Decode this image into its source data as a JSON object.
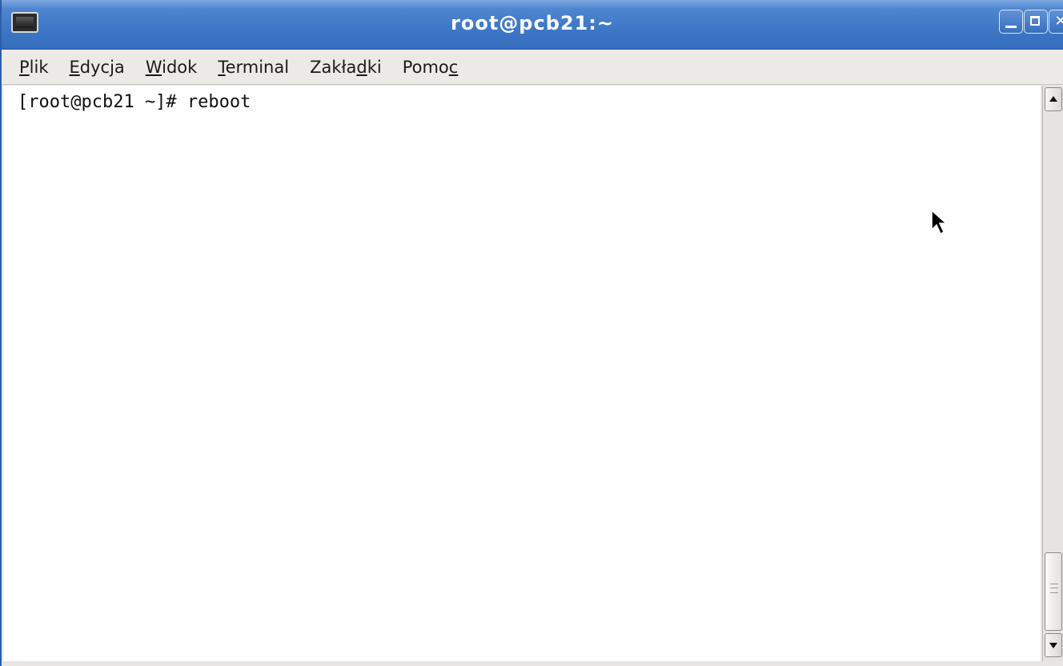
{
  "window": {
    "title": "root@pcb21:~",
    "icon": "terminal-icon",
    "controls": {
      "minimize_icon": "minimize-icon",
      "maximize_icon": "maximize-icon",
      "close_icon": "close-icon",
      "close_glyph": "✕"
    },
    "colors": {
      "titlebar": "#3f78c7",
      "menubar": "#eceae7",
      "terminal_bg": "#ffffff",
      "terminal_fg": "#111111"
    }
  },
  "menubar": {
    "items": [
      {
        "label_pre": "",
        "label_ul": "P",
        "label_post": "lik"
      },
      {
        "label_pre": "",
        "label_ul": "E",
        "label_post": "dycja"
      },
      {
        "label_pre": "",
        "label_ul": "W",
        "label_post": "idok"
      },
      {
        "label_pre": "",
        "label_ul": "T",
        "label_post": "erminal"
      },
      {
        "label_pre": "Zakła",
        "label_ul": "d",
        "label_post": "ki"
      },
      {
        "label_pre": "Pomo",
        "label_ul": "c",
        "label_post": ""
      }
    ]
  },
  "terminal": {
    "lines": [
      "[root@pcb21 ~]# reboot"
    ]
  },
  "scrollbar": {
    "up_icon": "arrow-up-icon",
    "down_icon": "arrow-down-icon"
  }
}
